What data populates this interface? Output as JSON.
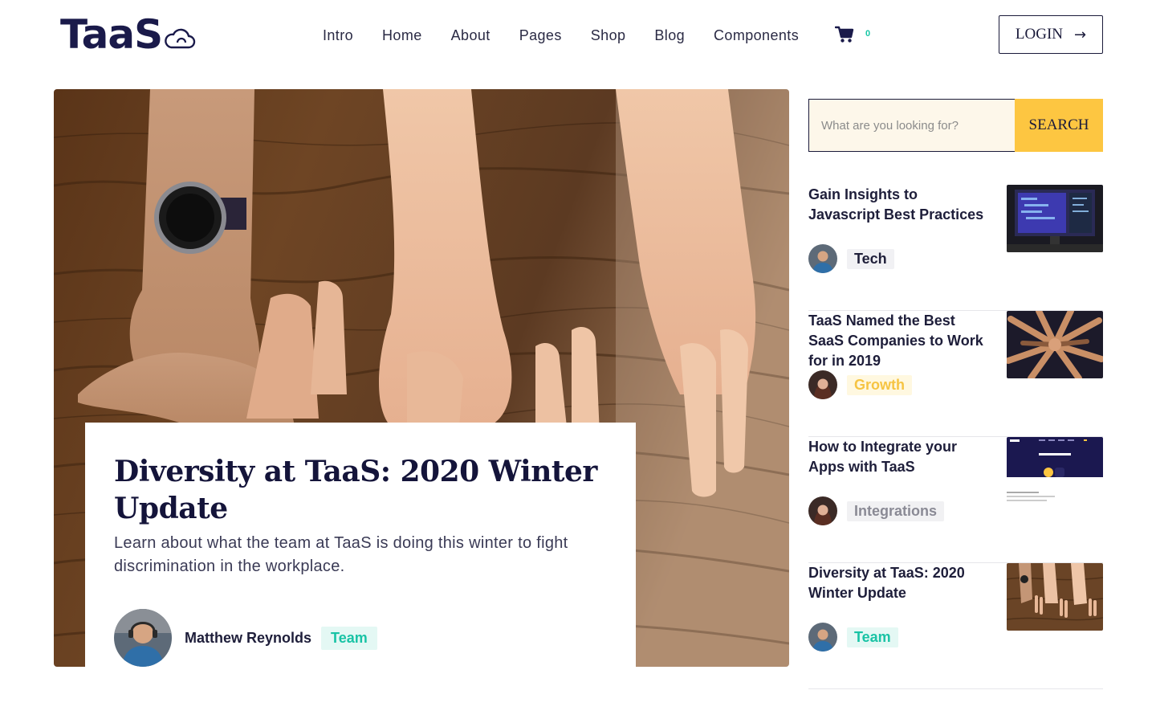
{
  "brand": {
    "name": "TaaS",
    "icon": "cloud-icon"
  },
  "nav": [
    "Intro",
    "Home",
    "About",
    "Pages",
    "Shop",
    "Blog",
    "Components"
  ],
  "cart": {
    "icon": "cart-icon",
    "count": "0"
  },
  "login": {
    "label": "LOGIN",
    "icon": "arrow-right-icon"
  },
  "hero": {
    "title": "Diversity at TaaS: 2020 Winter Update",
    "excerpt": "Learn about what the team at TaaS is doing this winter to fight discrimination in the workplace.",
    "author": "Matthew Reynolds",
    "tag": "Team"
  },
  "search": {
    "placeholder": "What are you looking for?",
    "button": "SEARCH"
  },
  "posts": [
    {
      "title": "Gain Insights to Javascript Best Practices",
      "tag": "Tech"
    },
    {
      "title": "TaaS Named the Best SaaS Companies to Work for in 2019",
      "tag": "Growth"
    },
    {
      "title": "How to Integrate your Apps with TaaS",
      "tag": "Integrations"
    },
    {
      "title": "Diversity at TaaS: 2020 Winter Update",
      "tag": "Team"
    }
  ],
  "colors": {
    "navy": "#1a1a4a",
    "accent_yellow": "#fdc641",
    "team_green": "#19c3a5",
    "search_bg": "#fdf7ea"
  }
}
